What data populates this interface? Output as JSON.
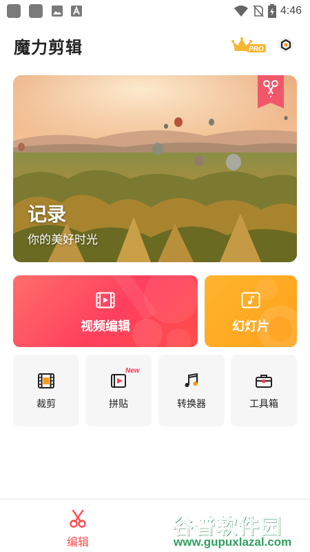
{
  "status_bar": {
    "time": "4:46",
    "left_icons": [
      "notification-icon",
      "notification-icon",
      "image-icon",
      "font-icon"
    ],
    "right_icons": [
      "wifi-icon",
      "no-sim-icon",
      "battery-charging-icon"
    ]
  },
  "header": {
    "title": "魔力剪辑",
    "pro_badge": "PRO"
  },
  "banner": {
    "title": "记录",
    "subtitle": "你的美好时光"
  },
  "main_cards": {
    "video_edit": "视频编辑",
    "slideshow": "幻灯片"
  },
  "tools": [
    {
      "label": "裁剪",
      "icon": "crop-film-icon"
    },
    {
      "label": "拼贴",
      "icon": "collage-icon",
      "badge": "New"
    },
    {
      "label": "转换器",
      "icon": "music-note-icon"
    },
    {
      "label": "工具箱",
      "icon": "toolbox-icon"
    }
  ],
  "bottom_nav": {
    "edit_label": "编辑"
  },
  "watermark": {
    "main": "谷普软件园",
    "url": "www.gupuxlazal.com"
  },
  "colors": {
    "accent_red": "#ff4a4a",
    "card_red": "#ff3f5d",
    "card_orange": "#ffa01a",
    "pro_gold": "#f7b733"
  }
}
